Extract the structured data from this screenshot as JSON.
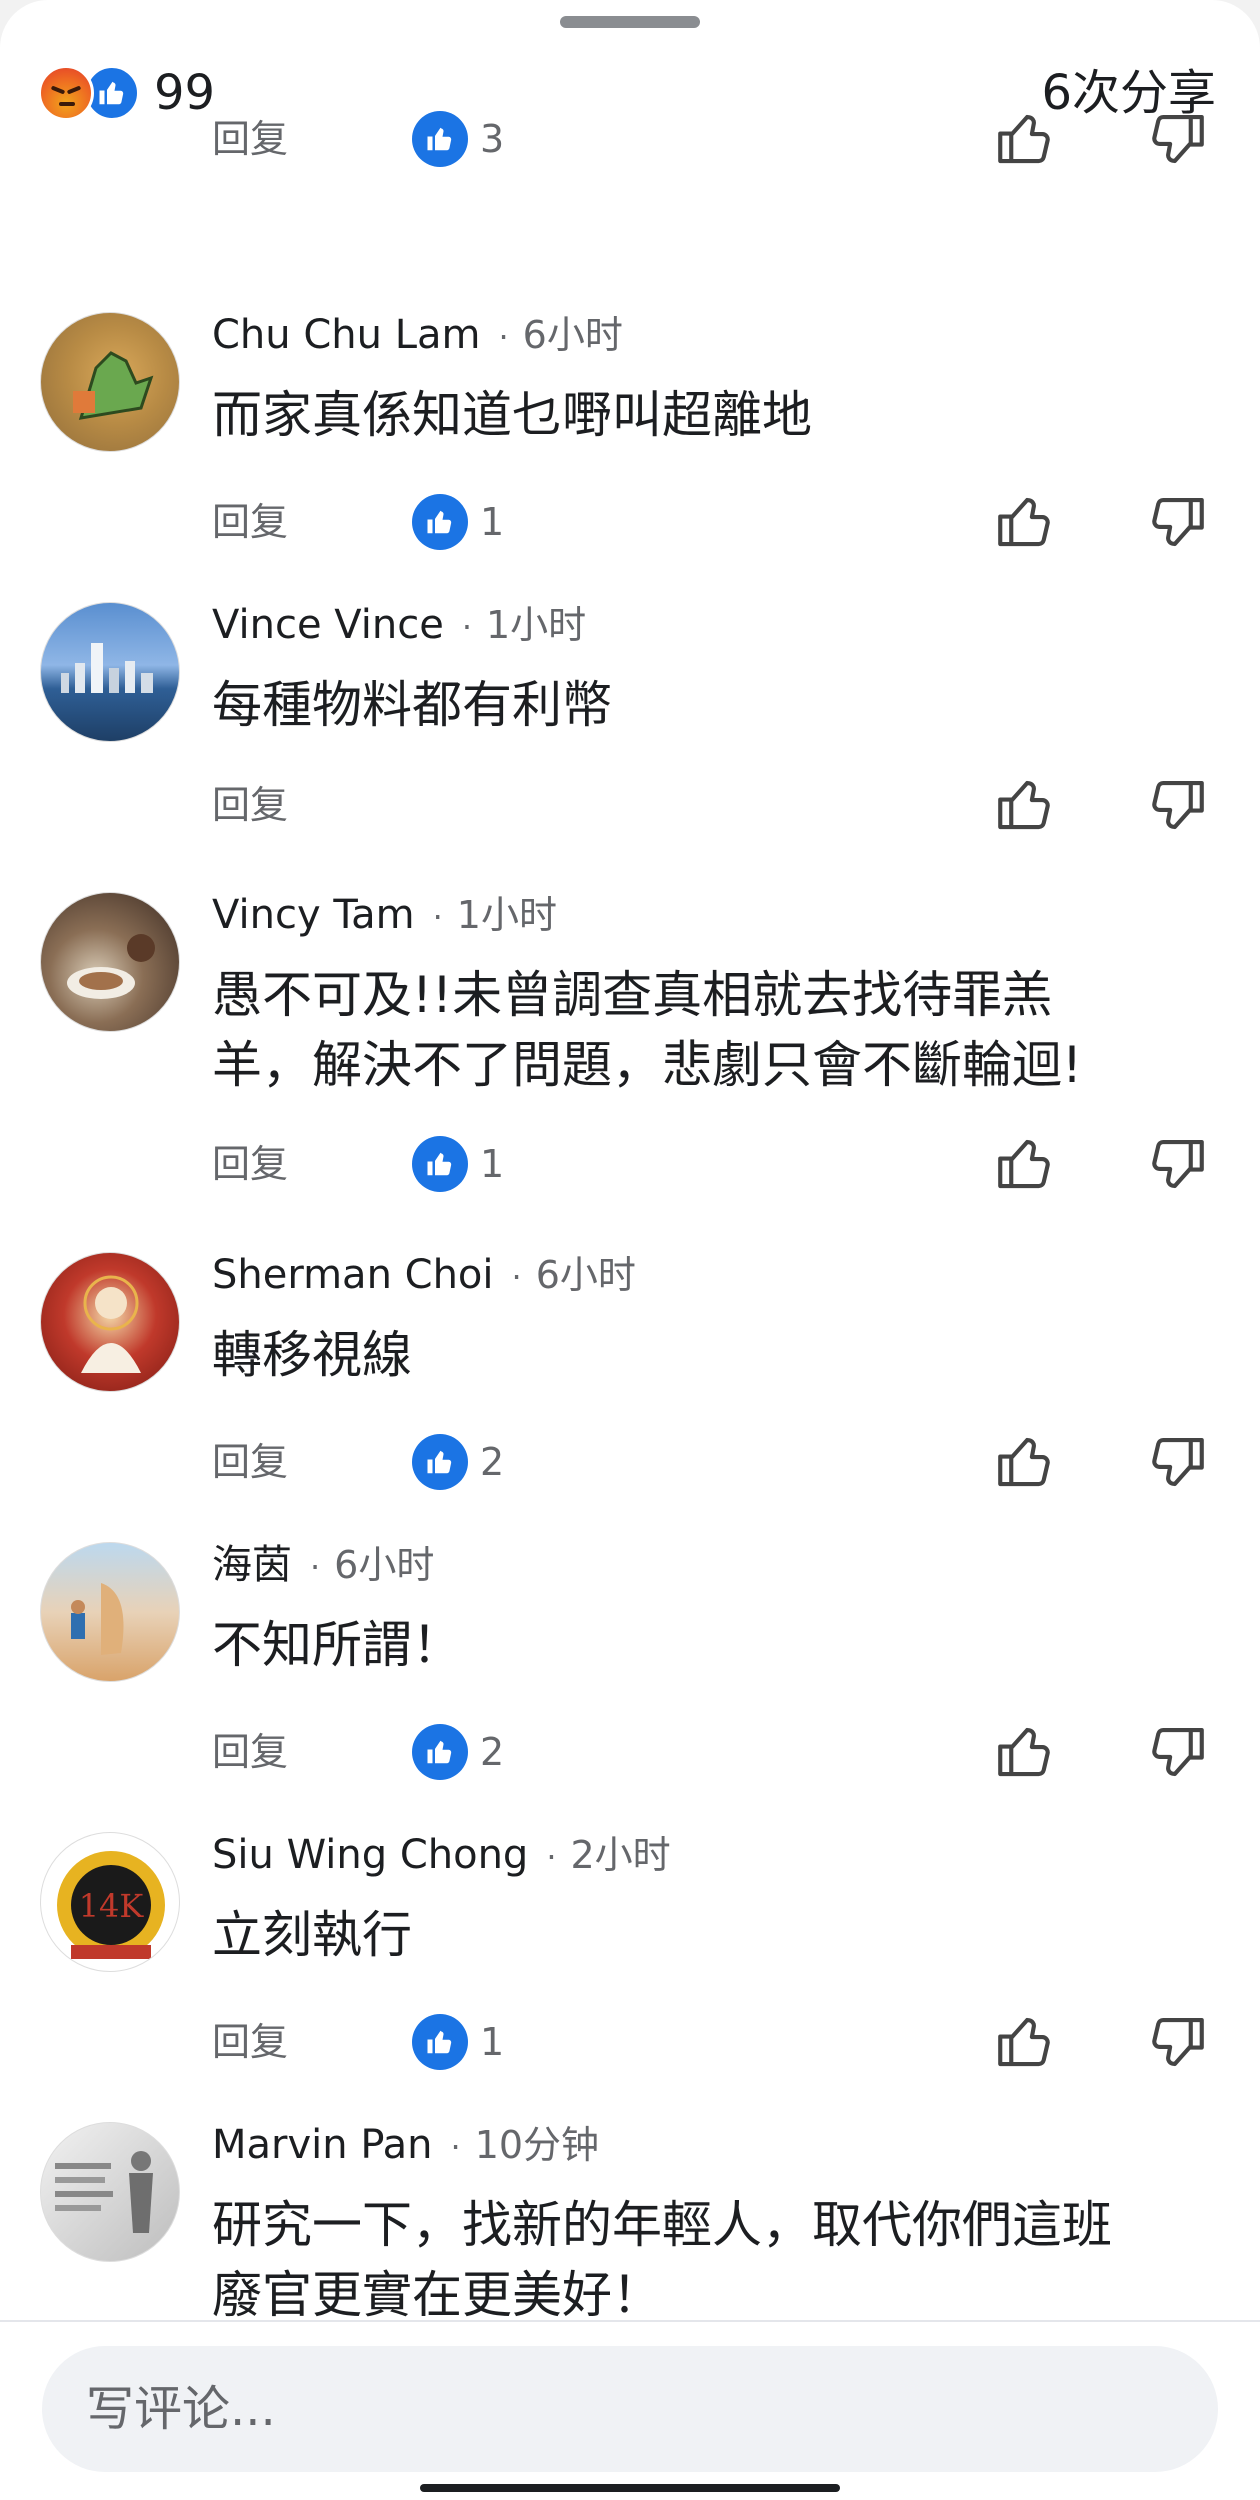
{
  "reactions": {
    "count": "99",
    "types": [
      "angry-emoji",
      "like-emoji"
    ],
    "shares_label": "6次分享"
  },
  "reply_label": "回复",
  "top_fragment": {
    "likes": "3"
  },
  "comments": [
    {
      "name": "Chu Chu Lam",
      "time": "6小时",
      "lines": [
        "而家真係知道乜嘢叫超離地"
      ],
      "likes": "1"
    },
    {
      "name": "Vince Vince",
      "time": "1小时",
      "lines": [
        "每種物料都有利幣"
      ],
      "likes": null
    },
    {
      "name": "Vincy Tam",
      "time": "1小时",
      "lines": [
        "愚不可及!!未曾調查真相就去找待罪羔",
        "羊，解決不了問題，悲劇只會不斷輪迴!"
      ],
      "likes": "1"
    },
    {
      "name": "Sherman Choi",
      "time": "6小时",
      "lines": [
        "轉移視線"
      ],
      "likes": "2"
    },
    {
      "name": "海茵",
      "time": "6小时",
      "lines": [
        "不知所謂！"
      ],
      "likes": "2"
    },
    {
      "name": "Siu Wing Chong",
      "time": "2小时",
      "lines": [
        "立刻執行"
      ],
      "likes": "1"
    },
    {
      "name": "Marvin Pan",
      "time": "10分钟",
      "lines": [
        "研究一下，找新的年輕人，取代你們這班",
        "廢官更實在更美好！"
      ],
      "likes": null
    }
  ],
  "composer": {
    "placeholder": "写评论..."
  },
  "colors": {
    "accent": "#1b74e4",
    "muted": "#65676b",
    "text": "#1c1e21"
  }
}
